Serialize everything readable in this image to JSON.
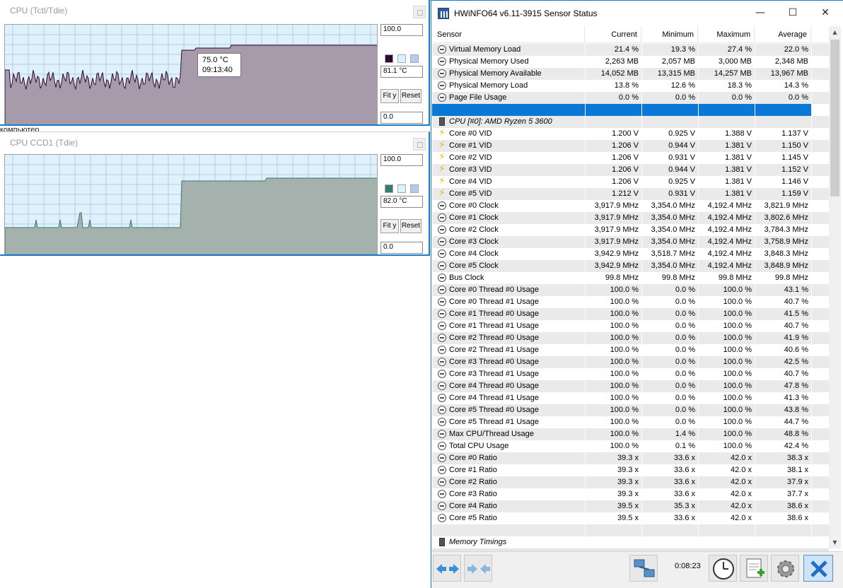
{
  "graph1": {
    "title": "CPU (Tctl/Tdie)",
    "max": "100.0",
    "current": "81.1 °C",
    "min": "0.0",
    "fit_label": "Fit y",
    "reset_label": "Reset",
    "tooltip_value": "75.0 °C",
    "tooltip_time": "09:13:40",
    "series_color": "#2e0b2e"
  },
  "graph2": {
    "title": "CPU CCD1 (Tdie)",
    "max": "100.0",
    "current": "82.0 °C",
    "min": "0.0",
    "fit_label": "Fit y",
    "reset_label": "Reset",
    "series_color": "#3a7a70"
  },
  "background_text": "компьютер",
  "hwinfo": {
    "title": "HWiNFO64 v6.11-3915 Sensor Status",
    "minimize": "—",
    "maximize": "☐",
    "close": "✕",
    "columns": [
      "Sensor",
      "Current",
      "Minimum",
      "Maximum",
      "Average"
    ],
    "rows": [
      {
        "icon": "circle",
        "label": "Virtual Memory Load",
        "cur": "21.4 %",
        "min": "19.3 %",
        "max": "27.4 %",
        "avg": "22.0 %"
      },
      {
        "icon": "circle",
        "label": "Physical Memory Used",
        "cur": "2,263 MB",
        "min": "2,057 MB",
        "max": "3,000 MB",
        "avg": "2,348 MB"
      },
      {
        "icon": "circle",
        "label": "Physical Memory Available",
        "cur": "14,052 MB",
        "min": "13,315 MB",
        "max": "14,257 MB",
        "avg": "13,967 MB"
      },
      {
        "icon": "circle",
        "label": "Physical Memory Load",
        "cur": "13.8 %",
        "min": "12.6 %",
        "max": "18.3 %",
        "avg": "14.3 %"
      },
      {
        "icon": "circle",
        "label": "Page File Usage",
        "cur": "0.0 %",
        "min": "0.0 %",
        "max": "0.0 %",
        "avg": "0.0 %"
      },
      {
        "icon": "none",
        "label": "",
        "cur": "",
        "min": "",
        "max": "",
        "avg": "",
        "selected": true
      },
      {
        "icon": "chip",
        "label": "CPU [#0]: AMD Ryzen 5 3600",
        "cur": "",
        "min": "",
        "max": "",
        "avg": "",
        "group": true
      },
      {
        "icon": "bolt",
        "label": "Core #0 VID",
        "cur": "1.200 V",
        "min": "0.925 V",
        "max": "1.388 V",
        "avg": "1.137 V"
      },
      {
        "icon": "bolt",
        "label": "Core #1 VID",
        "cur": "1.206 V",
        "min": "0.944 V",
        "max": "1.381 V",
        "avg": "1.150 V"
      },
      {
        "icon": "bolt",
        "label": "Core #2 VID",
        "cur": "1.206 V",
        "min": "0.931 V",
        "max": "1.381 V",
        "avg": "1.145 V"
      },
      {
        "icon": "bolt",
        "label": "Core #3 VID",
        "cur": "1.206 V",
        "min": "0.944 V",
        "max": "1.381 V",
        "avg": "1.152 V"
      },
      {
        "icon": "bolt",
        "label": "Core #4 VID",
        "cur": "1.206 V",
        "min": "0.925 V",
        "max": "1.381 V",
        "avg": "1.146 V"
      },
      {
        "icon": "bolt",
        "label": "Core #5 VID",
        "cur": "1.212 V",
        "min": "0.931 V",
        "max": "1.381 V",
        "avg": "1.159 V"
      },
      {
        "icon": "circle",
        "label": "Core #0 Clock",
        "cur": "3,917.9 MHz",
        "min": "3,354.0 MHz",
        "max": "4,192.4 MHz",
        "avg": "3,821.9 MHz"
      },
      {
        "icon": "circle",
        "label": "Core #1 Clock",
        "cur": "3,917.9 MHz",
        "min": "3,354.0 MHz",
        "max": "4,192.4 MHz",
        "avg": "3,802.6 MHz"
      },
      {
        "icon": "circle",
        "label": "Core #2 Clock",
        "cur": "3,917.9 MHz",
        "min": "3,354.0 MHz",
        "max": "4,192.4 MHz",
        "avg": "3,784.3 MHz"
      },
      {
        "icon": "circle",
        "label": "Core #3 Clock",
        "cur": "3,917.9 MHz",
        "min": "3,354.0 MHz",
        "max": "4,192.4 MHz",
        "avg": "3,758.9 MHz"
      },
      {
        "icon": "circle",
        "label": "Core #4 Clock",
        "cur": "3,942.9 MHz",
        "min": "3,518.7 MHz",
        "max": "4,192.4 MHz",
        "avg": "3,848.3 MHz"
      },
      {
        "icon": "circle",
        "label": "Core #5 Clock",
        "cur": "3,942.9 MHz",
        "min": "3,354.0 MHz",
        "max": "4,192.4 MHz",
        "avg": "3,848.9 MHz"
      },
      {
        "icon": "circle",
        "label": "Bus Clock",
        "cur": "99.8 MHz",
        "min": "99.8 MHz",
        "max": "99.8 MHz",
        "avg": "99.8 MHz"
      },
      {
        "icon": "circle",
        "label": "Core #0 Thread #0 Usage",
        "cur": "100.0 %",
        "min": "0.0 %",
        "max": "100.0 %",
        "avg": "43.1 %"
      },
      {
        "icon": "circle",
        "label": "Core #0 Thread #1 Usage",
        "cur": "100.0 %",
        "min": "0.0 %",
        "max": "100.0 %",
        "avg": "40.7 %"
      },
      {
        "icon": "circle",
        "label": "Core #1 Thread #0 Usage",
        "cur": "100.0 %",
        "min": "0.0 %",
        "max": "100.0 %",
        "avg": "41.5 %"
      },
      {
        "icon": "circle",
        "label": "Core #1 Thread #1 Usage",
        "cur": "100.0 %",
        "min": "0.0 %",
        "max": "100.0 %",
        "avg": "40.7 %"
      },
      {
        "icon": "circle",
        "label": "Core #2 Thread #0 Usage",
        "cur": "100.0 %",
        "min": "0.0 %",
        "max": "100.0 %",
        "avg": "41.9 %"
      },
      {
        "icon": "circle",
        "label": "Core #2 Thread #1 Usage",
        "cur": "100.0 %",
        "min": "0.0 %",
        "max": "100.0 %",
        "avg": "40.6 %"
      },
      {
        "icon": "circle",
        "label": "Core #3 Thread #0 Usage",
        "cur": "100.0 %",
        "min": "0.0 %",
        "max": "100.0 %",
        "avg": "42.5 %"
      },
      {
        "icon": "circle",
        "label": "Core #3 Thread #1 Usage",
        "cur": "100.0 %",
        "min": "0.0 %",
        "max": "100.0 %",
        "avg": "40.7 %"
      },
      {
        "icon": "circle",
        "label": "Core #4 Thread #0 Usage",
        "cur": "100.0 %",
        "min": "0.0 %",
        "max": "100.0 %",
        "avg": "47.8 %"
      },
      {
        "icon": "circle",
        "label": "Core #4 Thread #1 Usage",
        "cur": "100.0 %",
        "min": "0.0 %",
        "max": "100.0 %",
        "avg": "41.3 %"
      },
      {
        "icon": "circle",
        "label": "Core #5 Thread #0 Usage",
        "cur": "100.0 %",
        "min": "0.0 %",
        "max": "100.0 %",
        "avg": "43.8 %"
      },
      {
        "icon": "circle",
        "label": "Core #5 Thread #1 Usage",
        "cur": "100.0 %",
        "min": "0.0 %",
        "max": "100.0 %",
        "avg": "44.7 %"
      },
      {
        "icon": "circle",
        "label": "Max CPU/Thread Usage",
        "cur": "100.0 %",
        "min": "1.4 %",
        "max": "100.0 %",
        "avg": "48.8 %"
      },
      {
        "icon": "circle",
        "label": "Total CPU Usage",
        "cur": "100.0 %",
        "min": "0.1 %",
        "max": "100.0 %",
        "avg": "42.4 %"
      },
      {
        "icon": "circle",
        "label": "Core #0 Ratio",
        "cur": "39.3 x",
        "min": "33.6 x",
        "max": "42.0 x",
        "avg": "38.3 x"
      },
      {
        "icon": "circle",
        "label": "Core #1 Ratio",
        "cur": "39.3 x",
        "min": "33.6 x",
        "max": "42.0 x",
        "avg": "38.1 x"
      },
      {
        "icon": "circle",
        "label": "Core #2 Ratio",
        "cur": "39.3 x",
        "min": "33.6 x",
        "max": "42.0 x",
        "avg": "37.9 x"
      },
      {
        "icon": "circle",
        "label": "Core #3 Ratio",
        "cur": "39.3 x",
        "min": "33.6 x",
        "max": "42.0 x",
        "avg": "37.7 x"
      },
      {
        "icon": "circle",
        "label": "Core #4 Ratio",
        "cur": "39.5 x",
        "min": "35.3 x",
        "max": "42.0 x",
        "avg": "38.6 x"
      },
      {
        "icon": "circle",
        "label": "Core #5 Ratio",
        "cur": "39.5 x",
        "min": "33.6 x",
        "max": "42.0 x",
        "avg": "38.6 x"
      },
      {
        "icon": "none",
        "label": "",
        "cur": "",
        "min": "",
        "max": "",
        "avg": ""
      },
      {
        "icon": "chip",
        "label": "Memory Timings",
        "cur": "",
        "min": "",
        "max": "",
        "avg": "",
        "group": true
      }
    ],
    "timer": "0:08:23"
  },
  "colors": {
    "accent": "#1979ca",
    "selection": "#0a78d7",
    "plot_bg": "#dff1fb",
    "plot_fill_1": "#a69aab",
    "plot_fill_2": "#a4b1ac"
  }
}
